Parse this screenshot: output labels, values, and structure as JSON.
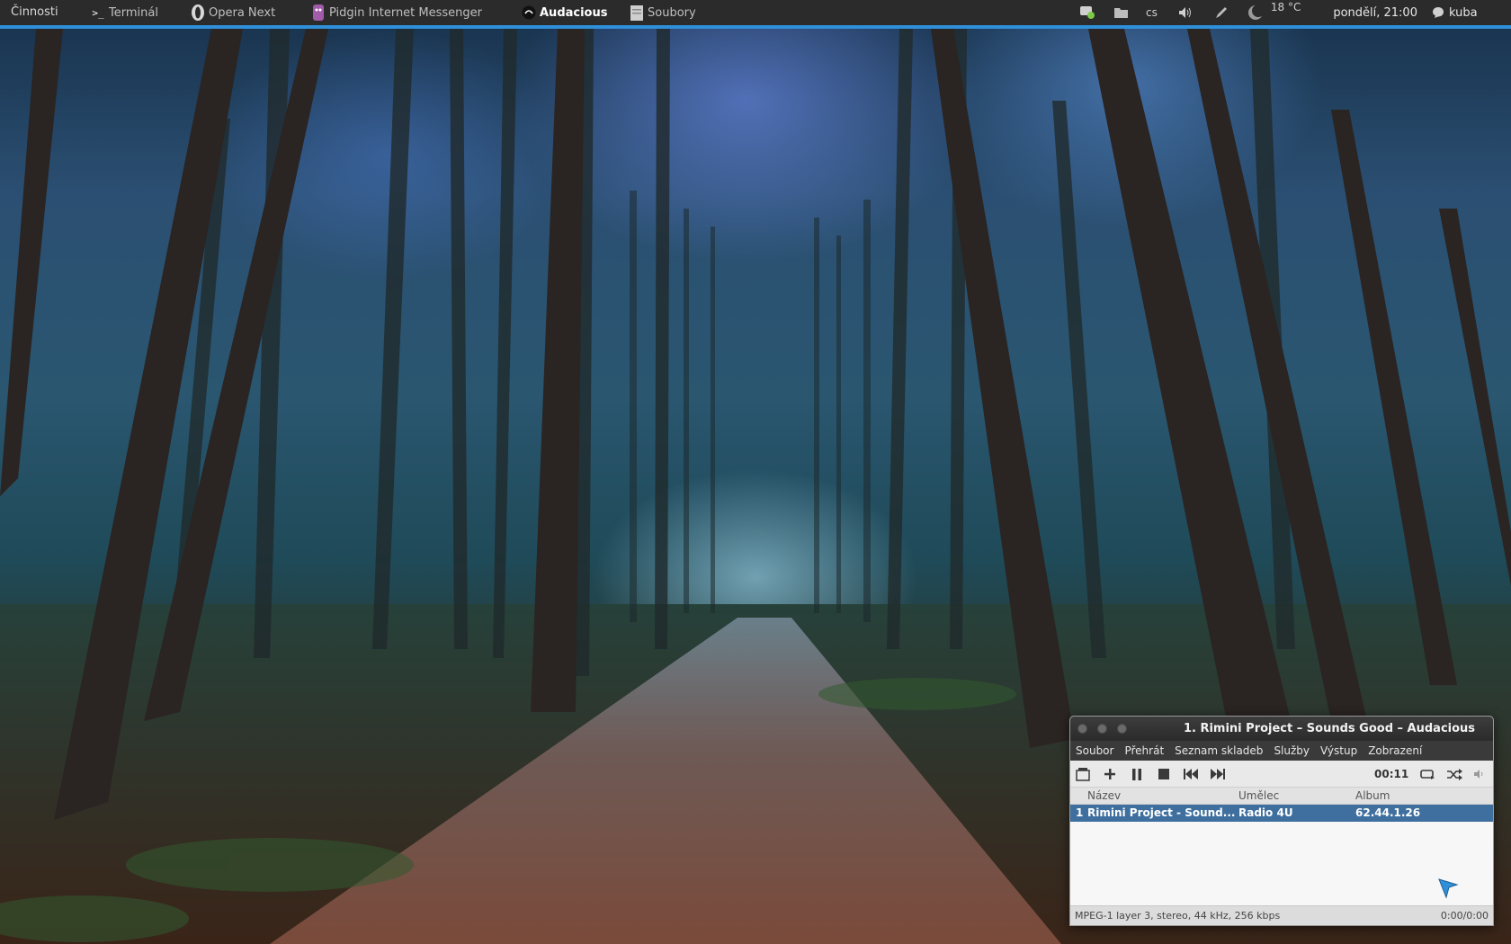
{
  "top_panel": {
    "activities": "Činnosti",
    "tasks": [
      {
        "label": "Terminál",
        "icon": "terminal-icon"
      },
      {
        "label": "Opera Next",
        "icon": "opera-icon"
      },
      {
        "label": "Pidgin Internet Messenger",
        "icon": "pidgin-icon"
      },
      {
        "label": "Audacious",
        "icon": "audacious-icon",
        "active": true
      },
      {
        "label": "Soubory",
        "icon": "files-icon"
      }
    ],
    "tray": {
      "keyboard_layout": "cs",
      "temperature": "18 °C",
      "clock": "pondělí, 21:00",
      "user": "kuba"
    },
    "accent_color": "#2f8fd8"
  },
  "audacious": {
    "title": "1. Rimini Project – Sounds Good – Audacious",
    "menu": [
      "Soubor",
      "Přehrát",
      "Seznam skladeb",
      "Služby",
      "Výstup",
      "Zobrazení"
    ],
    "time": "00:11",
    "columns": {
      "name": "Název",
      "artist": "Umělec",
      "album": "Album"
    },
    "rows": [
      {
        "num": "1",
        "title": "Rimini Project - Sound...",
        "artist": "Radio 4U",
        "album": "62.44.1.26"
      }
    ],
    "status": {
      "info": "MPEG-1 layer 3, stereo, 44 kHz, 256 kbps",
      "length": "0:00/0:00"
    },
    "selection_color": "#3f6f9e"
  }
}
